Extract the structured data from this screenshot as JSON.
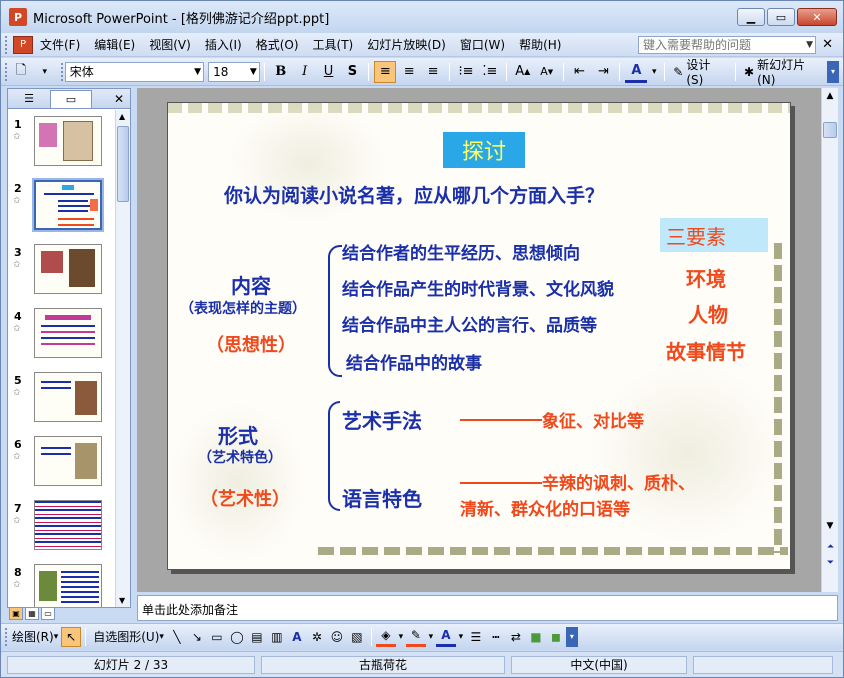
{
  "window": {
    "title": "Microsoft PowerPoint - [格列佛游记介绍ppt.ppt]",
    "buttons": [
      "minimize",
      "maximize",
      "close"
    ]
  },
  "menu": {
    "items": [
      "文件(F)",
      "编辑(E)",
      "视图(V)",
      "插入(I)",
      "格式(O)",
      "工具(T)",
      "幻灯片放映(D)",
      "窗口(W)",
      "帮助(H)"
    ],
    "help_placeholder": "键入需要帮助的问题"
  },
  "toolbar": {
    "font_name": "宋体",
    "font_size": "18",
    "design_label": "设计(S)",
    "new_slide_label": "新幻灯片(N)"
  },
  "slides_panel": {
    "numbers": [
      "1",
      "2",
      "3",
      "4",
      "5",
      "6",
      "7",
      "8"
    ],
    "selected": "2"
  },
  "slide": {
    "title": "探讨",
    "question": "你认为阅读小说名著，应从哪几个方面入手？",
    "content_label": "内容",
    "content_sub": "（表现怎样的主题）",
    "content_tag": "（思想性）",
    "content_items": [
      "结合作者的生平经历、思想倾向",
      "结合作品产生的时代背景、文化风貌",
      "结合作品中主人公的言行、品质等",
      "结合作品中的故事"
    ],
    "three_elements": "三要素",
    "elements": [
      "环境",
      "人物",
      "故事情节"
    ],
    "form_label": "形式",
    "form_sub": "（艺术特色）",
    "form_tag": "（艺术性）",
    "form_item1": "艺术手法",
    "form_item1_detail": "象征、对比等",
    "form_item2": "语言特色",
    "form_item2_detail_line1": "辛辣的讽刺、质朴、",
    "form_item2_detail_line2": "清新、群众化的口语等"
  },
  "notes": {
    "placeholder": "单击此处添加备注"
  },
  "drawbar": {
    "draw_label": "绘图(R)",
    "autoshape_label": "自选图形(U)"
  },
  "status": {
    "slide_info": "幻灯片 2 / 33",
    "template": "古瓶荷花",
    "language": "中文(中国)"
  },
  "colors": {
    "accent_blue": "#1a2fa8",
    "accent_red": "#f0491b",
    "title_bg": "#2aa7e6",
    "title_fg": "#ffff66"
  }
}
